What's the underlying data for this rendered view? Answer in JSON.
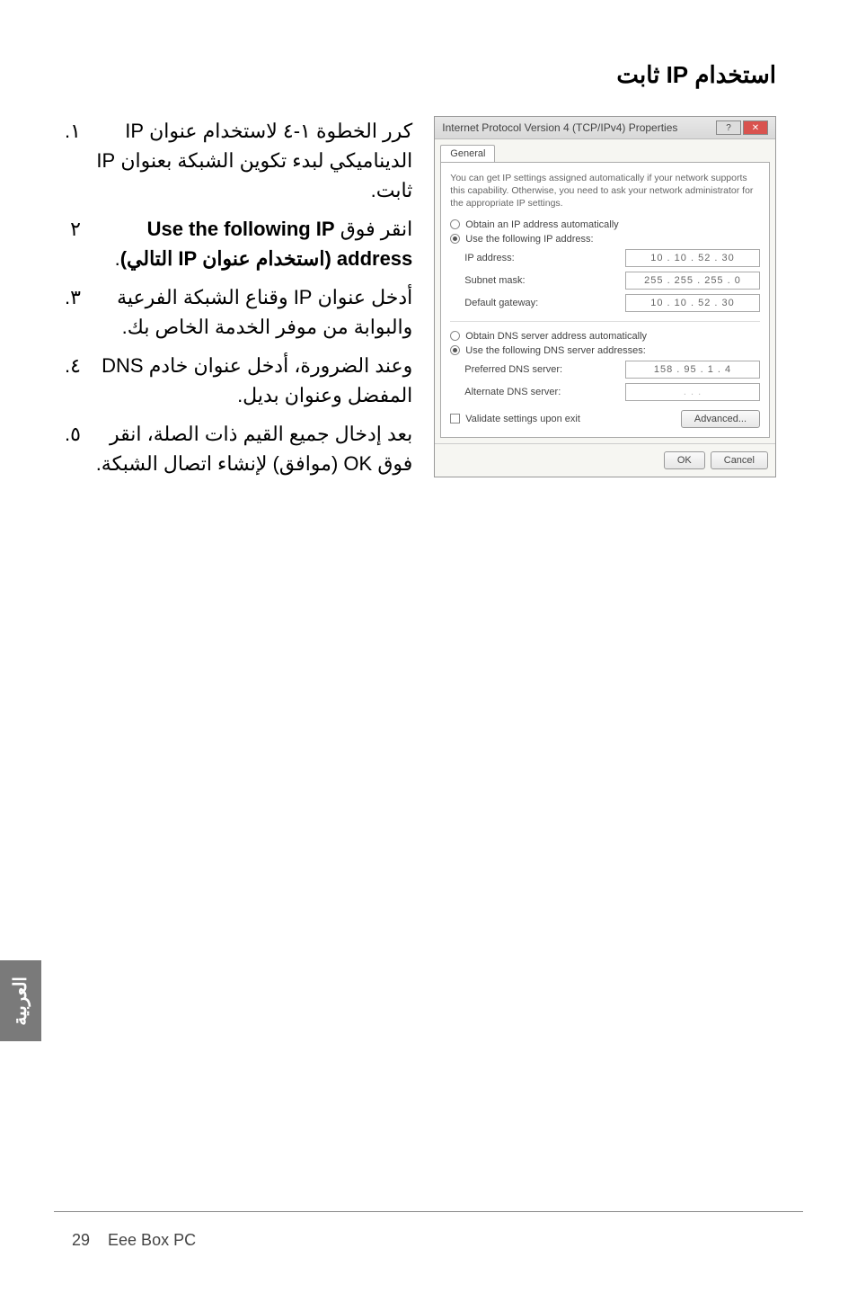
{
  "heading": "استخدام IP ثابت",
  "steps": [
    {
      "num": "١.",
      "body": "كرر الخطوة ١-٤ لاستخدام عنوان IP الديناميكي لبدء تكوين الشبكة بعنوان IP ثابت."
    },
    {
      "num": "٢",
      "body_prefix": "انقر فوق ",
      "body_bold": "Use the following IP address (استخدام عنوان IP التالي)",
      "body_suffix": "."
    },
    {
      "num": "٣.",
      "body": "أدخل عنوان IP وقناع الشبكة الفرعية والبوابة من موفر الخدمة الخاص بك."
    },
    {
      "num": "٤.",
      "body": "وعند الضرورة، أدخل عنوان خادم DNS المفضل وعنوان بديل."
    },
    {
      "num": "٥.",
      "body": "بعد إدخال جميع القيم ذات الصلة، انقر فوق OK (موافق) لإنشاء اتصال الشبكة."
    }
  ],
  "dialog": {
    "title": "Internet Protocol Version 4 (TCP/IPv4) Properties",
    "tab": "General",
    "help": "You can get IP settings assigned automatically if your network supports this capability. Otherwise, you need to ask your network administrator for the appropriate IP settings.",
    "opt_auto_ip": "Obtain an IP address automatically",
    "opt_use_ip": "Use the following IP address:",
    "lbl_ip": "IP address:",
    "val_ip": "10 . 10 . 52 . 30",
    "lbl_mask": "Subnet mask:",
    "val_mask": "255 . 255 . 255 . 0",
    "lbl_gw": "Default gateway:",
    "val_gw": "10 . 10 . 52 . 30",
    "opt_auto_dns": "Obtain DNS server address automatically",
    "opt_use_dns": "Use the following DNS server addresses:",
    "lbl_pref_dns": "Preferred DNS server:",
    "val_pref_dns": "158 . 95 . 1 . 4",
    "lbl_alt_dns": "Alternate DNS server:",
    "val_alt_dns": " . . . ",
    "validate": "Validate settings upon exit",
    "btn_advanced": "Advanced...",
    "btn_ok": "OK",
    "btn_cancel": "Cancel"
  },
  "side_tab": "العربية",
  "footer": {
    "page": "29",
    "title": "Eee Box PC"
  }
}
